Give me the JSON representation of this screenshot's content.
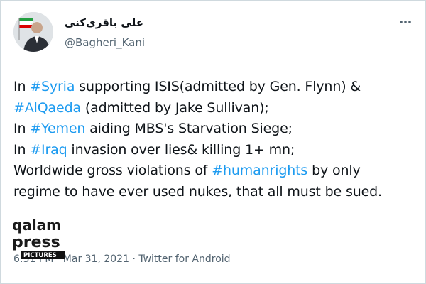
{
  "author": {
    "display_name": "علی باقری‌کنی",
    "handle": "@Bagheri_Kani"
  },
  "more_icon": "more-horizontal-icon",
  "tweet": {
    "lines": [
      [
        {
          "t": "In "
        },
        {
          "t": "#Syria",
          "tag": true
        },
        {
          "t": " supporting ISIS(admitted by Gen. Flynn) &"
        }
      ],
      [
        {
          "t": "#AlQaeda",
          "tag": true
        },
        {
          "t": " (admitted by Jake Sullivan);"
        }
      ],
      [
        {
          "t": "In "
        },
        {
          "t": "#Yemen",
          "tag": true
        },
        {
          "t": " aiding MBS's Starvation Siege;"
        }
      ],
      [
        {
          "t": "In "
        },
        {
          "t": "#Iraq",
          "tag": true
        },
        {
          "t": " invasion over lies& killing 1+ mn;"
        }
      ],
      [
        {
          "t": "Worldwide gross violations of "
        },
        {
          "t": "#humanrights",
          "tag": true
        },
        {
          "t": " by only"
        }
      ],
      [
        {
          "t": "regime to have ever used nukes, that all must be sued."
        }
      ]
    ]
  },
  "meta": {
    "time": "6:51 PM",
    "separator": "·",
    "date": "Mar 31, 2021",
    "source": "Twitter for Android"
  },
  "watermark": {
    "line1": "qalam",
    "line2": "press",
    "line3": "PICTURES"
  },
  "colors": {
    "link": "#1d9bf0",
    "text": "#0f1419",
    "muted": "#536471"
  }
}
